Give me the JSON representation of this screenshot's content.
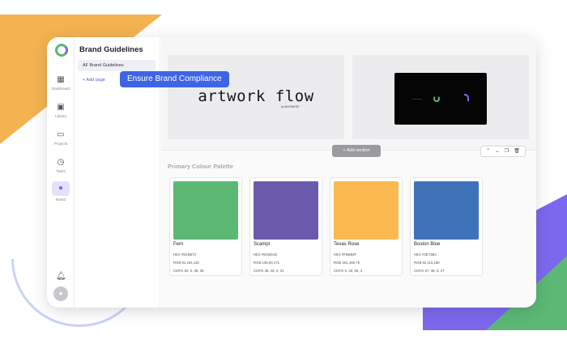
{
  "app": {
    "sidebar_title": "Brand Guidelines"
  },
  "rail": {
    "items": [
      {
        "label": "Dashboard",
        "icon": "grid-icon"
      },
      {
        "label": "Library",
        "icon": "library-icon"
      },
      {
        "label": "Projects",
        "icon": "folder-icon"
      },
      {
        "label": "Tasks",
        "icon": "clock-icon"
      },
      {
        "label": "Brand",
        "icon": "palette-icon",
        "active": true
      }
    ]
  },
  "pages": {
    "items": [
      {
        "label": "AF Brand Guidelines"
      }
    ],
    "add_label": "+ Add page"
  },
  "callout": "Ensure Brand Compliance",
  "hero": {
    "logo_text": "artwork flow",
    "logo_sub": "by BUSINESS"
  },
  "toolbar": {
    "add_section": "+ Add section"
  },
  "palette": {
    "title": "Primary Colour Palette",
    "colors": [
      {
        "name": "Fern",
        "hex": "#5CB874",
        "hex_line": "HEX #5CB873",
        "rgb_line": "RGB 91,184,115",
        "cmyk_line": "CMYK 50, 0, 38, 28"
      },
      {
        "name": "Scampi",
        "hex": "#6A5AAB",
        "hex_line": "HEX #6A5DAB",
        "rgb_line": "RGB 106,93,171",
        "cmyk_line": "CMYK 38, 46, 0, 33"
      },
      {
        "name": "Texas Rose",
        "hex": "#FBB94F",
        "hex_line": "HEX #FBB94F",
        "rgb_line": "RGB 251,185,79",
        "cmyk_line": "CMYK 0, 26, 69, 2"
      },
      {
        "name": "Boston Blue",
        "hex": "#3E73BA",
        "hex_line": "HEX #3E73BA",
        "rgb_line": "RGB 62,115,186",
        "cmyk_line": "CMYK 67, 38, 0, 27"
      }
    ]
  }
}
